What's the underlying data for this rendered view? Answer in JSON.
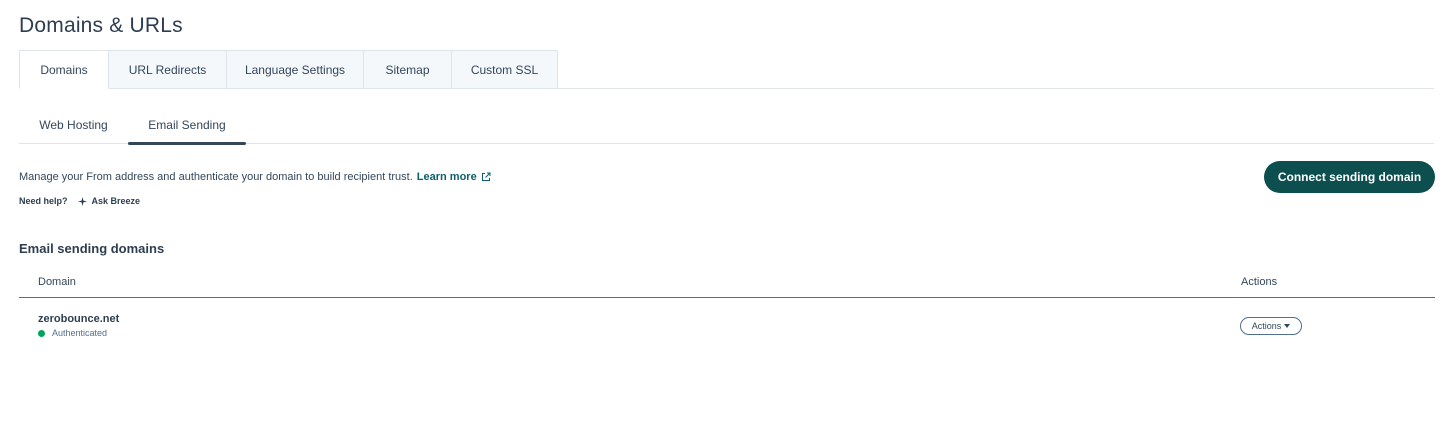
{
  "page": {
    "title": "Domains & URLs"
  },
  "tabs": [
    {
      "label": "Domains",
      "active": true
    },
    {
      "label": "URL Redirects",
      "active": false
    },
    {
      "label": "Language Settings",
      "active": false
    },
    {
      "label": "Sitemap",
      "active": false
    },
    {
      "label": "Custom SSL",
      "active": false
    }
  ],
  "subtabs": [
    {
      "label": "Web Hosting",
      "active": false
    },
    {
      "label": "Email Sending",
      "active": true
    }
  ],
  "intro": {
    "description": "Manage your From address and authenticate your domain to build recipient trust.",
    "learn_more": "Learn more",
    "need_help": "Need help?",
    "ask_breeze": "Ask Breeze",
    "connect_button": "Connect sending domain"
  },
  "section": {
    "title": "Email sending domains"
  },
  "table": {
    "headers": {
      "domain": "Domain",
      "actions": "Actions"
    },
    "rows": [
      {
        "domain": "zerobounce.net",
        "status": "Authenticated",
        "actions_label": "Actions"
      }
    ]
  },
  "colors": {
    "accent": "#0d4f4f",
    "link": "#0b5f6d",
    "status_authenticated": "#00a35c",
    "text": "#33475b"
  },
  "icons": {
    "external_link": "external-link-icon",
    "sparkle": "sparkle-icon",
    "caret": "caret-down-icon",
    "status": "status-dot-icon"
  }
}
